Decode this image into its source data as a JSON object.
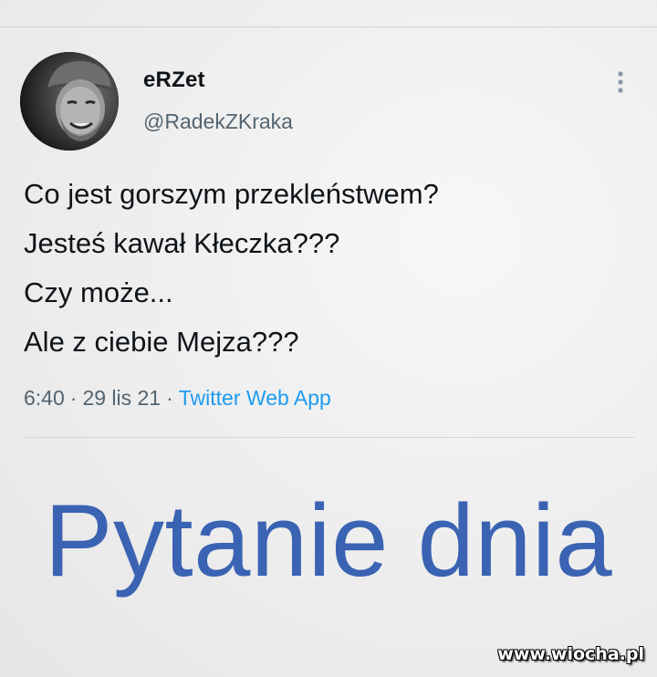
{
  "user": {
    "display_name": "eRZet",
    "handle": "@RadekZKraka",
    "avatar_icon": "profile-photo"
  },
  "tweet": {
    "lines": [
      "Co jest gorszym przekleństwem?",
      "Jesteś kawał Kłeczka???",
      "Czy może...",
      "Ale z ciebie Mejza???"
    ],
    "time": "6:40",
    "date": "29 lis 21",
    "separator": "·",
    "source": "Twitter Web App",
    "more_icon": "more-vertical-icon"
  },
  "caption": {
    "headline": "Pytanie dnia"
  },
  "watermark": "www.wiocha.pl",
  "colors": {
    "headline": "#3a63b3",
    "link": "#1d9bf0",
    "secondary_text": "#536471"
  }
}
